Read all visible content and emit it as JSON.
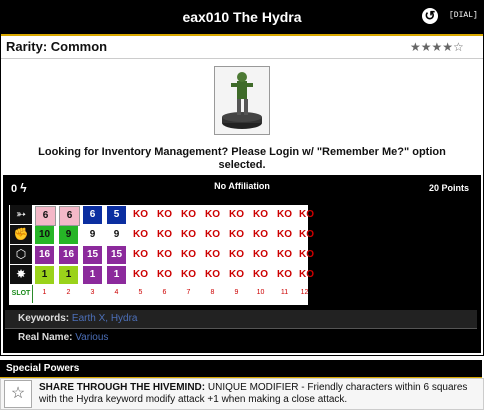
{
  "header": {
    "title": "eax010 The Hydra",
    "dial_link": "[DIAL]",
    "undo_icon": "undo-icon"
  },
  "rarity": {
    "text": "Rarity: Common",
    "stars": "★★★★☆"
  },
  "login_message": "Looking for Inventory Management? Please Login w/ \"Remember Me?\" option selected.",
  "dial": {
    "speed_prefix": "0",
    "affiliation": "No Affiliation",
    "points": "20 Points",
    "stat_icons": [
      "speed-icon",
      "attack-icon",
      "defense-icon",
      "damage-icon"
    ],
    "slot_label": "SLOT",
    "slots": [
      "1",
      "2",
      "3",
      "4",
      "5",
      "6",
      "7",
      "8",
      "9",
      "10",
      "11",
      "12"
    ],
    "rows": [
      [
        "6",
        "6",
        "6",
        "5",
        "KO",
        "KO",
        "KO",
        "KO",
        "KO",
        "KO",
        "KO",
        "KO"
      ],
      [
        "10",
        "9",
        "9",
        "9",
        "KO",
        "KO",
        "KO",
        "KO",
        "KO",
        "KO",
        "KO",
        "KO"
      ],
      [
        "16",
        "16",
        "15",
        "15",
        "KO",
        "KO",
        "KO",
        "KO",
        "KO",
        "KO",
        "KO",
        "KO"
      ],
      [
        "1",
        "1",
        "1",
        "1",
        "KO",
        "KO",
        "KO",
        "KO",
        "KO",
        "KO",
        "KO",
        "KO"
      ]
    ],
    "colors": {
      "pink": "#f4b8c8",
      "blue": "#0b2ea0",
      "green": "#26b526",
      "purple": "#8c2a9c",
      "lime": "#9ad21a",
      "ko": "#cc0000"
    },
    "keywords_label": "Keywords:",
    "keywords": "Earth X, Hydra",
    "realname_label": "Real Name:",
    "realname": "Various"
  },
  "special_powers": {
    "header": "Special Powers",
    "power_name": "SHARE THROUGH THE HIVEMIND:",
    "power_text": " UNIQUE MODIFIER - Friendly characters within 6 squares with the Hydra keyword modify attack +1 when making a close attack."
  }
}
